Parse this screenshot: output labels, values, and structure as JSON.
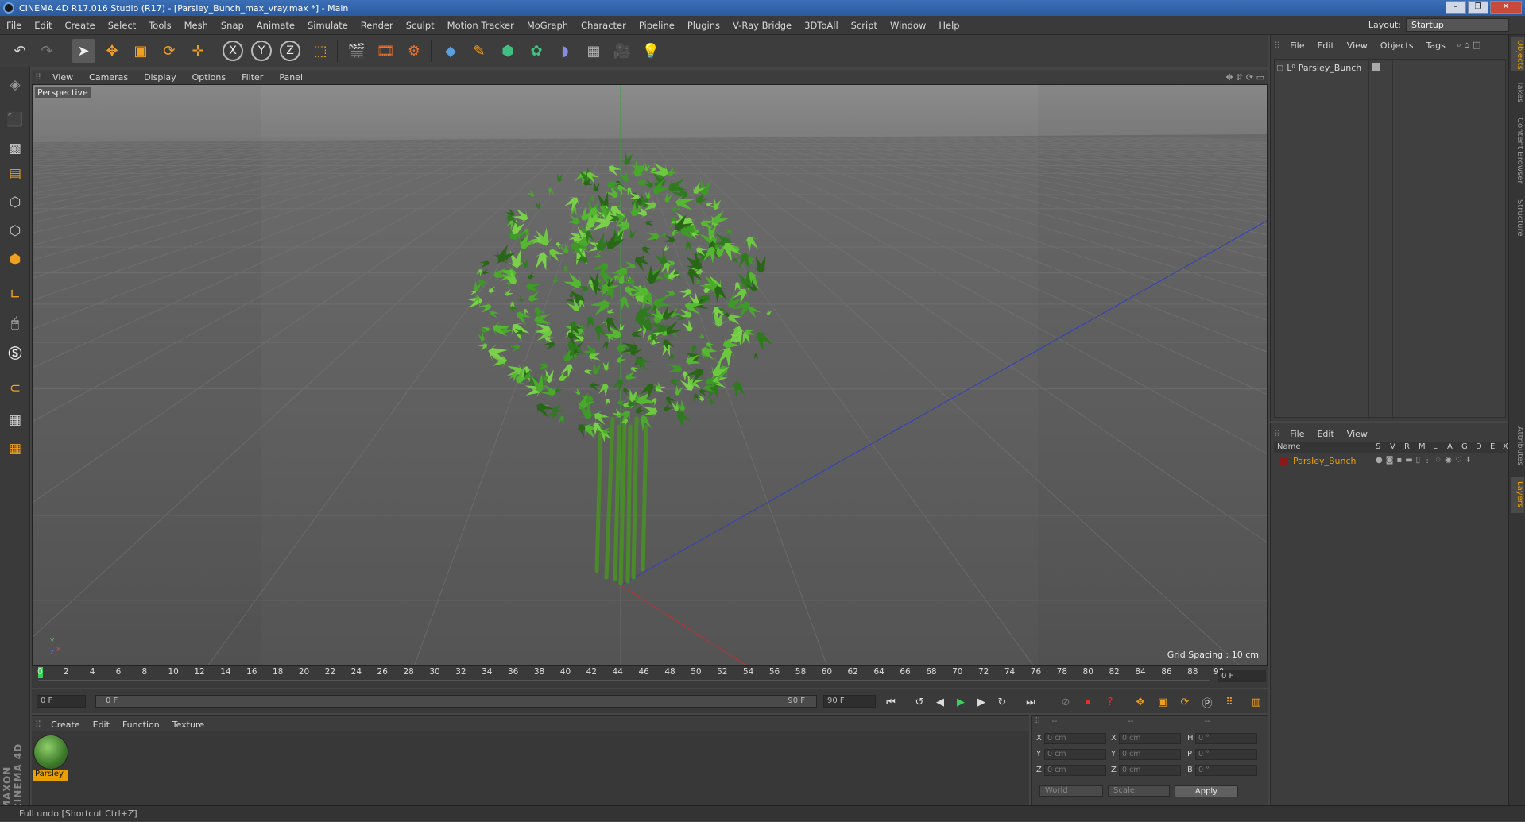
{
  "window": {
    "title": "CINEMA 4D R17.016 Studio (R17) - [Parsley_Bunch_max_vray.max *] - Main"
  },
  "menu": [
    "File",
    "Edit",
    "Create",
    "Select",
    "Tools",
    "Mesh",
    "Snap",
    "Animate",
    "Simulate",
    "Render",
    "Sculpt",
    "Motion Tracker",
    "MoGraph",
    "Character",
    "Pipeline",
    "Plugins",
    "V-Ray Bridge",
    "3DToAll",
    "Script",
    "Window",
    "Help"
  ],
  "layout": {
    "label": "Layout:",
    "value": "Startup"
  },
  "viewport": {
    "menu": [
      "View",
      "Cameras",
      "Display",
      "Options",
      "Filter",
      "Panel"
    ],
    "label": "Perspective",
    "grid_spacing": "Grid Spacing : 10 cm",
    "axis_x": "x",
    "axis_y": "y",
    "axis_z": "z"
  },
  "timeline": {
    "ticks": [
      "0",
      "2",
      "4",
      "6",
      "8",
      "10",
      "12",
      "14",
      "16",
      "18",
      "20",
      "22",
      "24",
      "26",
      "28",
      "30",
      "32",
      "34",
      "36",
      "38",
      "40",
      "42",
      "44",
      "46",
      "48",
      "50",
      "52",
      "54",
      "56",
      "58",
      "60",
      "62",
      "64",
      "66",
      "68",
      "70",
      "72",
      "74",
      "76",
      "78",
      "80",
      "82",
      "84",
      "86",
      "88",
      "90"
    ],
    "current_frame": "0 F"
  },
  "transport": {
    "start_field": "0 F",
    "range_start": "0 F",
    "range_end": "90 F",
    "end_field": "90 F"
  },
  "material_panel": {
    "menu": [
      "Create",
      "Edit",
      "Function",
      "Texture"
    ],
    "material_name": "Parsley"
  },
  "coordinates": {
    "header": [
      "--",
      "--",
      "--"
    ],
    "rows": [
      {
        "a": "X",
        "av": "0 cm",
        "b": "X",
        "bv": "0 cm",
        "c": "H",
        "cv": "0 °"
      },
      {
        "a": "Y",
        "av": "0 cm",
        "b": "Y",
        "bv": "0 cm",
        "c": "P",
        "cv": "0 °"
      },
      {
        "a": "Z",
        "av": "0 cm",
        "b": "Z",
        "bv": "0 cm",
        "c": "B",
        "cv": "0 °"
      }
    ],
    "world_dropdown": "World",
    "scale_dropdown": "Scale",
    "apply": "Apply"
  },
  "object_manager": {
    "menu": [
      "File",
      "Edit",
      "View",
      "Objects",
      "Tags"
    ],
    "object": "Parsley_Bunch"
  },
  "layer_manager": {
    "menu": [
      "File",
      "Edit",
      "View"
    ],
    "columns": [
      "Name",
      "S",
      "V",
      "R",
      "M",
      "L",
      "A",
      "G",
      "D",
      "E",
      "X"
    ],
    "layer": "Parsley_Bunch"
  },
  "right_tabs": [
    "Objects",
    "Takes",
    "Content Browser",
    "Structure",
    "Attributes",
    "Layers"
  ],
  "status": "Full undo [Shortcut Ctrl+Z]",
  "brand": "MAXON CINEMA 4D",
  "colors": {
    "accent": "#e8a000",
    "layer_color": "#8a1a1a",
    "plant_green": "#3fa62a"
  }
}
